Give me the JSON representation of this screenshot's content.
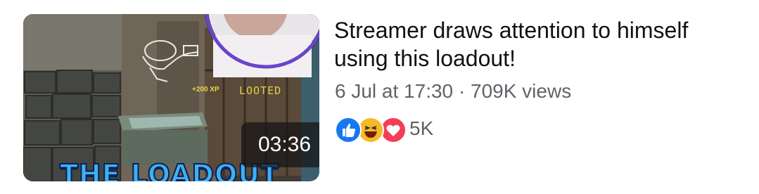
{
  "video": {
    "duration": "03:36",
    "thumbnail_text": {
      "headline": "THE LOADOUT",
      "xp": "+200 XP",
      "status": "LOOTED"
    },
    "title": "Streamer draws attention to himself using this loadout!",
    "meta": "6 Jul at 17:30 · 709K views",
    "reactions": {
      "icons": [
        "like-icon",
        "haha-icon",
        "love-icon"
      ],
      "count": "5K"
    }
  },
  "colors": {
    "like": "#1877f2",
    "haha": "#f7b928",
    "love": "#f33e58",
    "meta_text": "#5f6368",
    "title_text": "#111111"
  }
}
